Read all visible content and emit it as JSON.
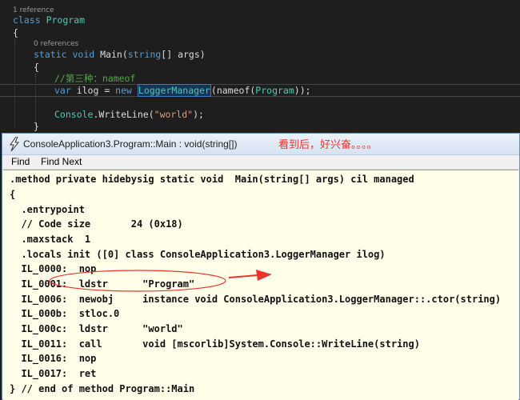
{
  "editor": {
    "ref1": "1 reference",
    "class_kw": "class",
    "class_name": "Program",
    "brace_open": "{",
    "ref0": "0 references",
    "static_kw": "static",
    "void_kw": "void",
    "main_name": "Main(",
    "string_kw": "string",
    "args": "[] args)",
    "inner_brace": "{",
    "comment": "//第三种：nameof",
    "var_kw": "var",
    "ilog": " ilog = ",
    "new_kw": "new",
    "logger_type": "LoggerManager",
    "nameof_call": "(nameof(",
    "program_ref": "Program",
    "end_call": "));",
    "console_type": "Console",
    "writeline": ".WriteLine(",
    "world_str": "\"world\"",
    "writeline_end": ");",
    "close_brace": "}"
  },
  "window": {
    "title": "ConsoleApplication3.Program::Main : void(string[])",
    "menu": [
      "Find",
      "Find Next"
    ]
  },
  "il_lines": [
    ".method private hidebysig static void  Main(string[] args) cil managed",
    "{",
    "  .entrypoint",
    "  // Code size       24 (0x18)",
    "  .maxstack  1",
    "  .locals init ([0] class ConsoleApplication3.LoggerManager ilog)",
    "  IL_0000:  nop",
    "  IL_0001:  ldstr      \"Program\"",
    "  IL_0006:  newobj     instance void ConsoleApplication3.LoggerManager::.ctor(string)",
    "  IL_000b:  stloc.0",
    "  IL_000c:  ldstr      \"world\"",
    "  IL_0011:  call       void [mscorlib]System.Console::WriteLine(string)",
    "  IL_0016:  nop",
    "  IL_0017:  ret",
    "} // end of method Program::Main"
  ],
  "annotation": "看到后，好兴奋。。。。",
  "colors": {
    "annotation": "#e8352e",
    "keyword": "#569cd6",
    "type": "#4ec9b0",
    "comment": "#57a64a",
    "string": "#d69d85"
  }
}
